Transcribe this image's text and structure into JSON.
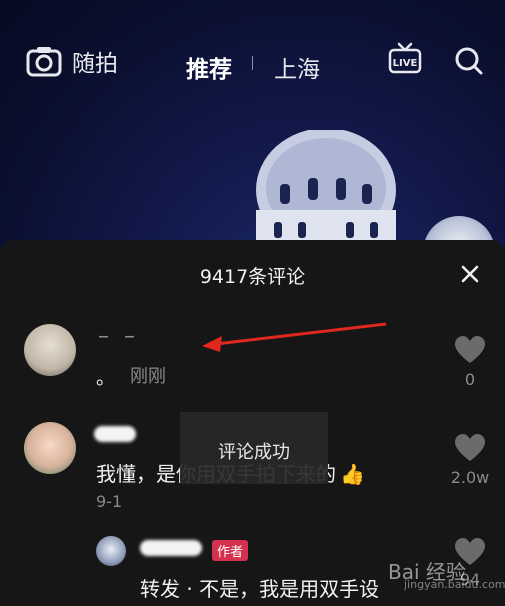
{
  "topbar": {
    "camera_label": "随拍",
    "tab_recommend": "推荐",
    "tab_city": "上海",
    "live_label": "LIVE"
  },
  "comments_sheet": {
    "title": "9417条评论",
    "comments": [
      {
        "name": "– –",
        "text": "。",
        "time": "刚刚",
        "likes": "0"
      },
      {
        "text": "我懂，是你用双手拍下来的",
        "date": "9-1",
        "likes": "2.0w"
      },
      {
        "author_badge": "作者",
        "text": "转发 · 不是，我是用双手设"
      }
    ]
  },
  "toast": {
    "text": "评论成功"
  },
  "watermark": {
    "text": "Bai 经验",
    "sub": "jingyan.baidu.com",
    "side_text": "94"
  },
  "colors": {
    "author_badge": "#d4314f",
    "sheet_bg": "#161616",
    "arrow": "#e0281f"
  }
}
